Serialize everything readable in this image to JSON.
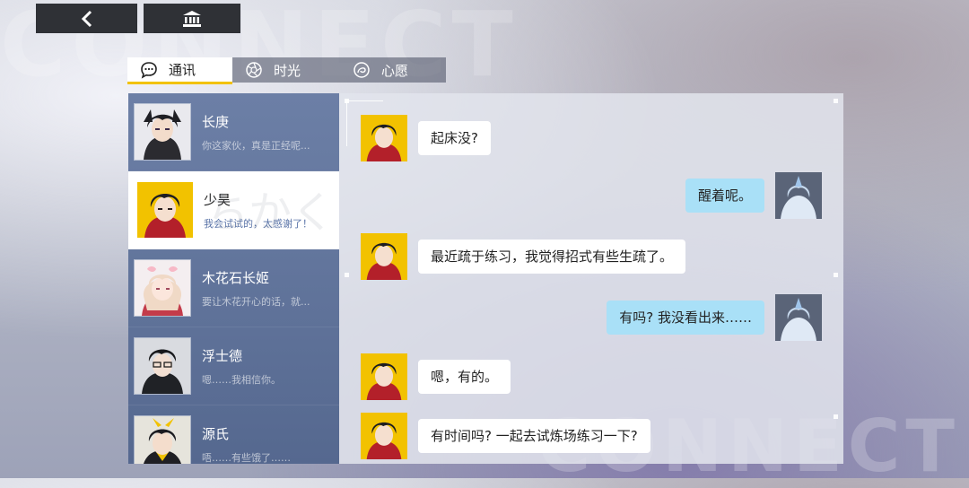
{
  "background_watermark": {
    "top": "CONNECT",
    "bottom": "CONNECT"
  },
  "top_buttons": {
    "back_icon": "chevron-left-icon",
    "home_icon": "museum-icon"
  },
  "tabs": [
    {
      "label": "通讯",
      "icon": "chat-bubble-icon",
      "active": true
    },
    {
      "label": "时光",
      "icon": "aperture-icon",
      "active": false
    },
    {
      "label": "心愿",
      "icon": "wish-spiral-icon",
      "active": false
    }
  ],
  "contacts": [
    {
      "name": "长庚",
      "preview": "你这家伙，真是正经呢...",
      "active": false
    },
    {
      "name": "少昊",
      "preview": "我会试试的，太感谢了！",
      "active": true,
      "deco": "ちかく"
    },
    {
      "name": "木花石长姬",
      "preview": "要让木花开心的话，就...",
      "active": false
    },
    {
      "name": "浮士德",
      "preview": "嗯……我相信你。",
      "active": false
    },
    {
      "name": "源氏",
      "preview": "唔……有些饿了……",
      "active": false
    }
  ],
  "messages": [
    {
      "side": "left",
      "text": "起床没?"
    },
    {
      "side": "right",
      "text": "醒着呢。"
    },
    {
      "side": "left",
      "text": "最近疏于练习，我觉得招式有些生疏了。"
    },
    {
      "side": "right",
      "text": "有吗? 我没看出来……"
    },
    {
      "side": "left",
      "text": "嗯，有的。"
    },
    {
      "side": "left",
      "text": "有时间吗? 一起去试炼场练习一下?"
    }
  ],
  "colors": {
    "accent": "#f2c200",
    "contacts_bg": "#5f7299",
    "self_bubble": "#a9e0f7",
    "other_bubble": "#ffffff",
    "topbar_button": "#2f3136"
  }
}
